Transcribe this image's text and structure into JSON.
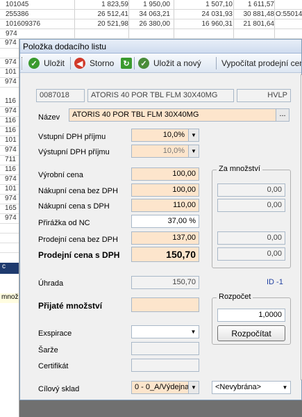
{
  "background_rows": [
    {
      "c1": "101045",
      "c2": "1 823,59",
      "c3": "1 950,00",
      "c4": "1 507,10",
      "c5": "1 611,57",
      "c6": ""
    },
    {
      "c1": "255386",
      "c2": "26 512,41",
      "c3": "34 063,21",
      "c4": "24 031,93",
      "c5": "30 881,48",
      "c6": "O:55014"
    },
    {
      "c1": "101609376",
      "c2": "20 521,98",
      "c3": "26 380,00",
      "c4": "16 960,31",
      "c5": "21 801,64",
      "c6": ""
    },
    {
      "c1": "974",
      "c2": "",
      "c3": "",
      "c4": "",
      "c5": "",
      "c6": ""
    }
  ],
  "left_strip": [
    "974",
    "",
    "974",
    "101",
    "974",
    "116",
    "974",
    "116",
    "116",
    "101",
    "974",
    "711",
    "116",
    "974",
    "101",
    "974",
    "165",
    "974"
  ],
  "left_strip_dark": "c",
  "left_strip_yellow": "množ",
  "dialog": {
    "title": "Položka dodacího listu",
    "toolbar": {
      "save": "Uložit",
      "cancel": "Storno",
      "save_new": "Uložit a nový",
      "compute_price": "Vypočítat prodejní ceny"
    },
    "header": {
      "code": "0087018",
      "name": "ATORIS 40 POR TBL FLM 30X40MG",
      "unit": "HVLP"
    },
    "name_label": "Název",
    "name_value": "ATORIS 40 POR TBL FLM 30X40MG",
    "name_button": "...",
    "vat_in_label": "Vstupní DPH příjmu",
    "vat_in_value": "10,0%",
    "vat_out_label": "Výstupní DPH příjmu",
    "vat_out_value": "10,0%",
    "production_price_label": "Výrobní cena",
    "production_price": "100,00",
    "purchase_net_label": "Nákupní cena bez DPH",
    "purchase_net": "100,00",
    "purchase_gross_label": "Nákupní cena s DPH",
    "purchase_gross": "110,00",
    "markup_label": "Přirážka od NC",
    "markup": "37,00 %",
    "sale_net_label": "Prodejní cena bez DPH",
    "sale_net": "137,00",
    "sale_gross_label": "Prodejní cena s DPH",
    "sale_gross": "150,70",
    "per_quantity_title": "Za množství",
    "per_quantity_values": [
      "0,00",
      "0,00",
      "0,00",
      "0,00"
    ],
    "payment_label": "Úhrada",
    "payment": "150,70",
    "id_text": "ID -1",
    "received_qty_label": "Přijaté množství",
    "received_qty": "",
    "budget_title": "Rozpočet",
    "budget_value": "1,0000",
    "budget_button": "Rozpočítat",
    "expiry_label": "Exspirace",
    "batch_label": "Šarže",
    "certificate_label": "Certifikát",
    "target_store_label": "Cílový sklad",
    "target_store": "0 - 0_A/Výdejna",
    "target_store2": "<Nevybrána>"
  },
  "colors": {
    "orange_field": "#fde5cc",
    "dark_cell": "#1e3a6e",
    "id_blue": "#1f3fa0"
  }
}
